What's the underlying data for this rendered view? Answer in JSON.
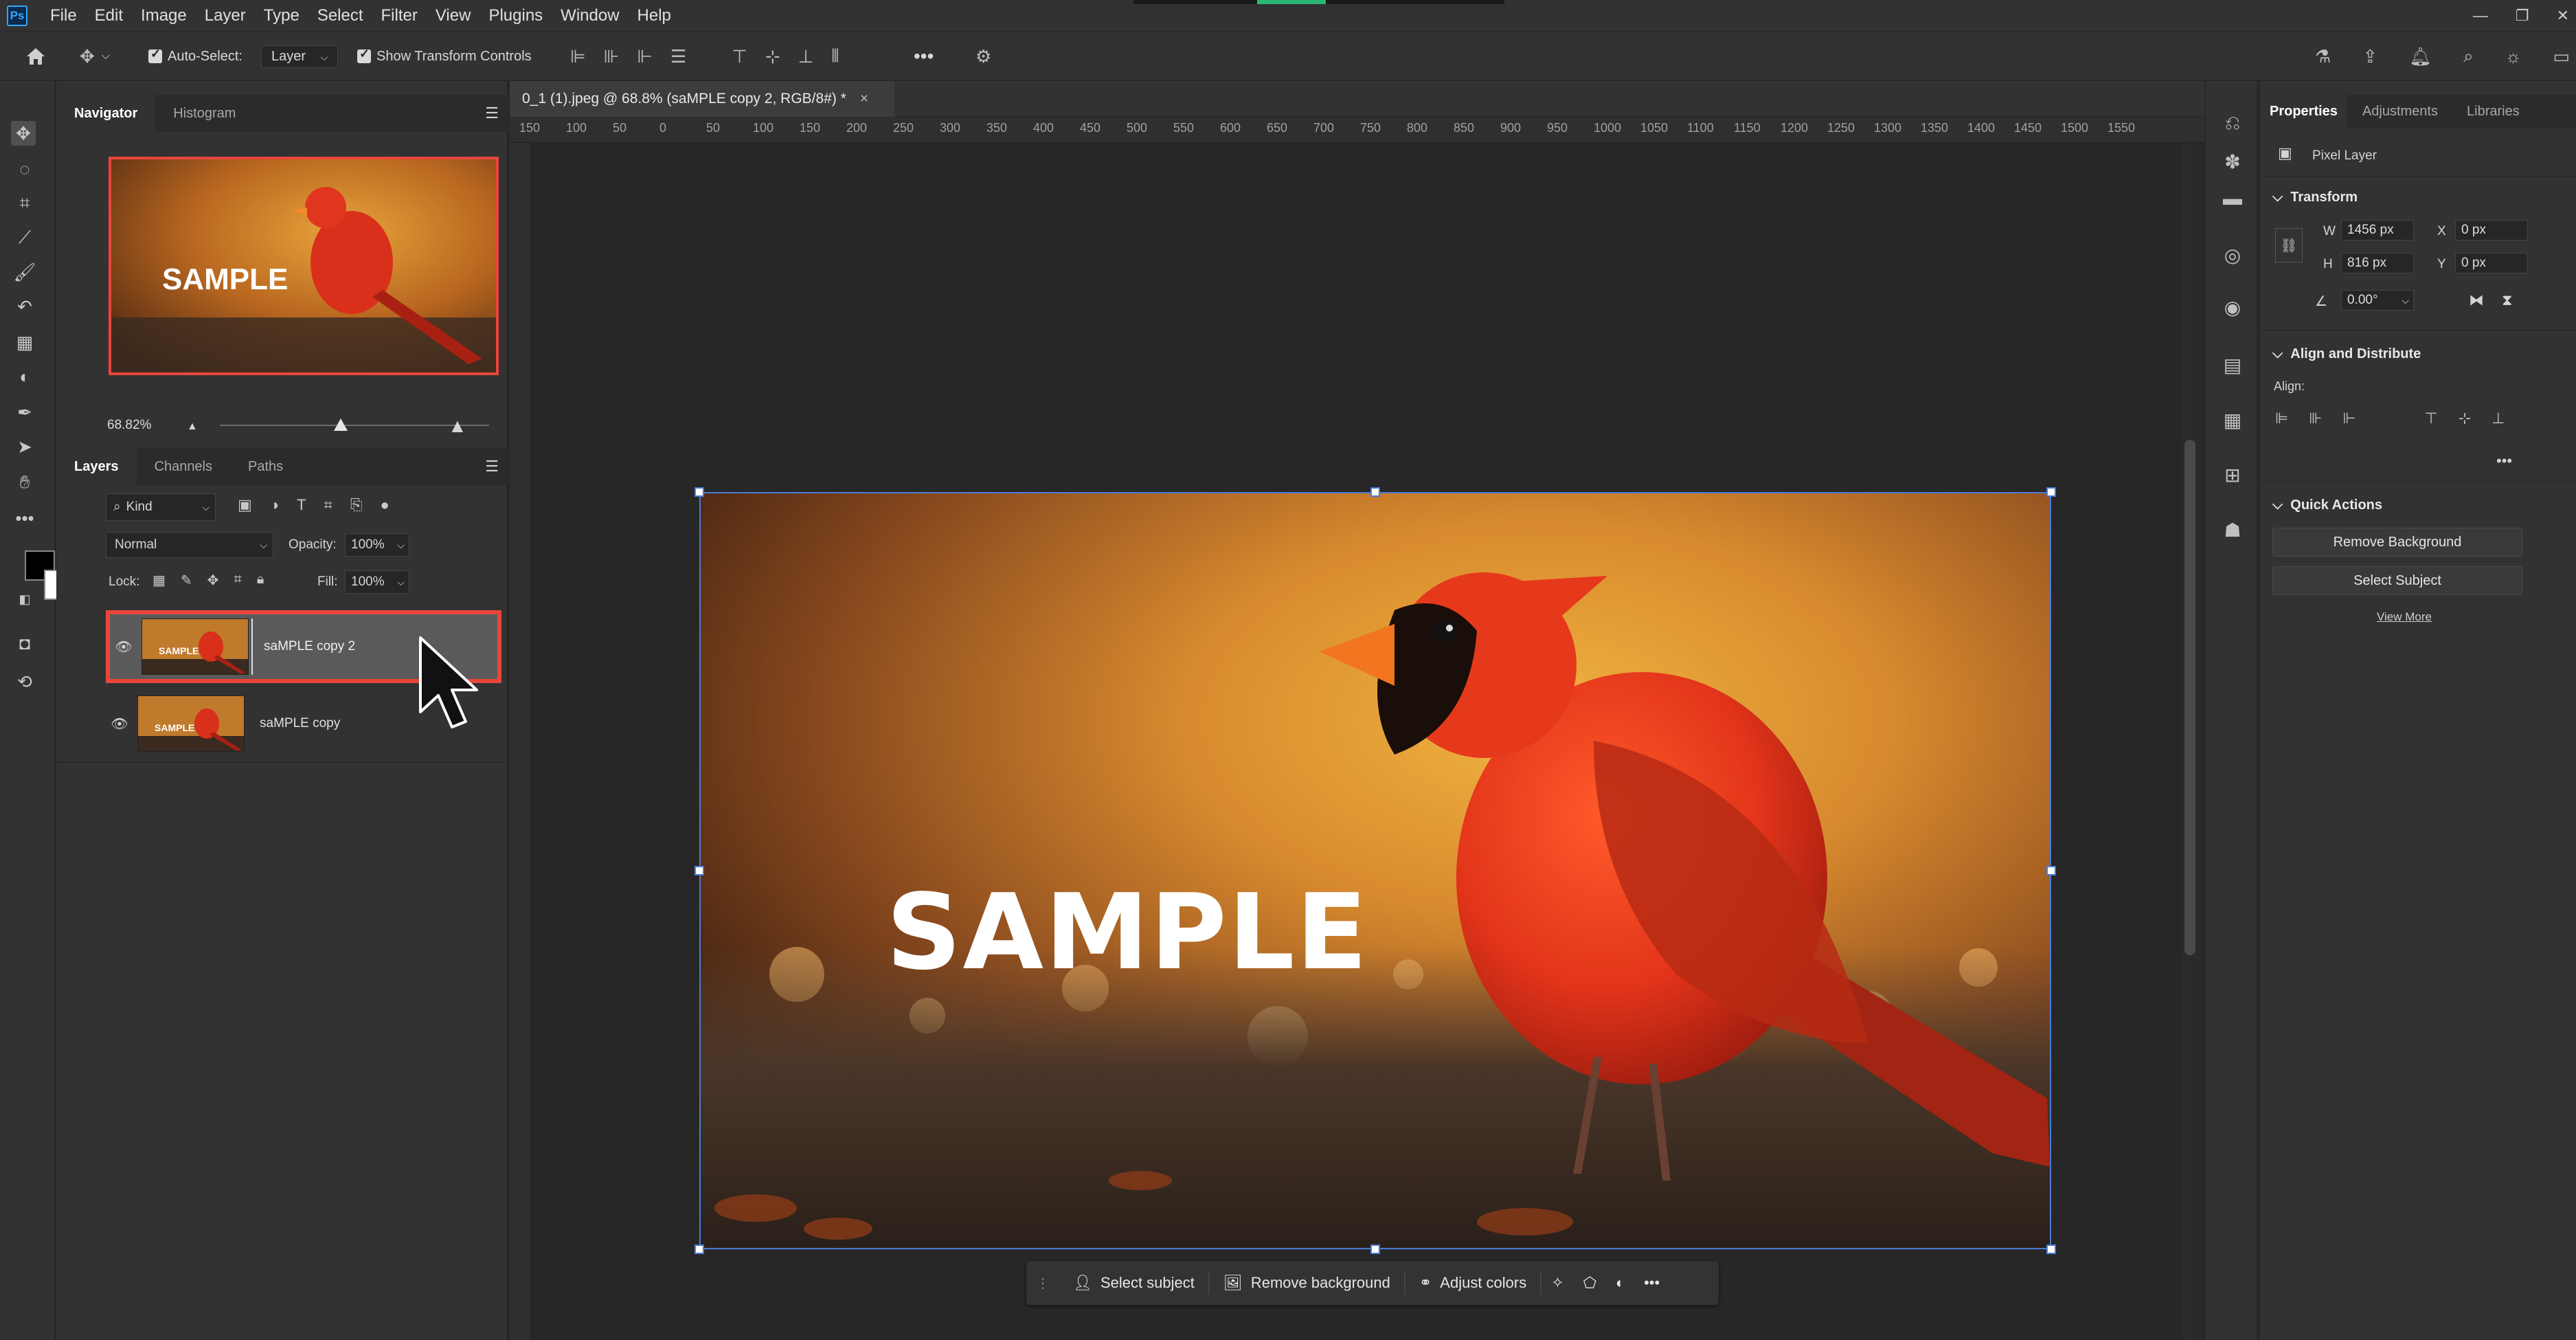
{
  "app": {
    "logo": "Ps",
    "menu": [
      "File",
      "Edit",
      "Image",
      "Layer",
      "Type",
      "Select",
      "Filter",
      "View",
      "Plugins",
      "Window",
      "Help"
    ]
  },
  "options_bar": {
    "auto_select_label": "Auto-Select:",
    "auto_select_value": "Layer",
    "show_transform_label": "Show Transform Controls",
    "more": "•••"
  },
  "document": {
    "tab_title": "0_1 (1).jpeg @ 68.8% (saMPLE copy 2, RGB/8#) *",
    "close": "×",
    "ruler_ticks": [
      "150",
      "100",
      "50",
      "0",
      "50",
      "100",
      "150",
      "200",
      "250",
      "300",
      "350",
      "400",
      "450",
      "500",
      "550",
      "600",
      "650",
      "700",
      "750",
      "800",
      "850",
      "900",
      "950",
      "1000",
      "1050",
      "1100",
      "1150",
      "1200",
      "1250",
      "1300",
      "1350",
      "1400",
      "1450",
      "1500",
      "1550"
    ],
    "watermark_text": "SAMPLE"
  },
  "navigator": {
    "tabs": [
      "Navigator",
      "Histogram"
    ],
    "thumb_text": "SAMPLE",
    "zoom": "68.82%",
    "zoom_slider_fraction": 0.45
  },
  "layers_panel": {
    "tabs": [
      "Layers",
      "Channels",
      "Paths"
    ],
    "filter_kind": "Kind",
    "blend_mode": "Normal",
    "opacity_label": "Opacity:",
    "opacity_value": "100%",
    "lock_label": "Lock:",
    "fill_label": "Fill:",
    "fill_value": "100%",
    "layers": [
      {
        "name": "saMPLE copy 2",
        "thumb_text": "SAMPLE",
        "selected": true
      },
      {
        "name": "saMPLE copy",
        "thumb_text": "SAMPLE",
        "selected": false
      }
    ]
  },
  "task_bar": {
    "select_subject": "Select subject",
    "remove_background": "Remove background",
    "adjust_colors": "Adjust colors",
    "more": "•••"
  },
  "properties": {
    "tabs": [
      "Properties",
      "Adjustments",
      "Libraries"
    ],
    "layer_type": "Pixel Layer",
    "transform_title": "Transform",
    "w_label": "W",
    "w_value": "1456 px",
    "h_label": "H",
    "h_value": "816 px",
    "x_label": "X",
    "x_value": "0 px",
    "y_label": "Y",
    "y_value": "0 px",
    "angle_value": "0.00°",
    "align_title": "Align and Distribute",
    "align_label": "Align:",
    "quick_actions_title": "Quick Actions",
    "remove_background_btn": "Remove Background",
    "select_subject_btn": "Select Subject",
    "view_more": "View More",
    "more": "•••"
  },
  "colors": {
    "accent_selection": "#e8463c",
    "transform_box": "#4a7bd5"
  }
}
